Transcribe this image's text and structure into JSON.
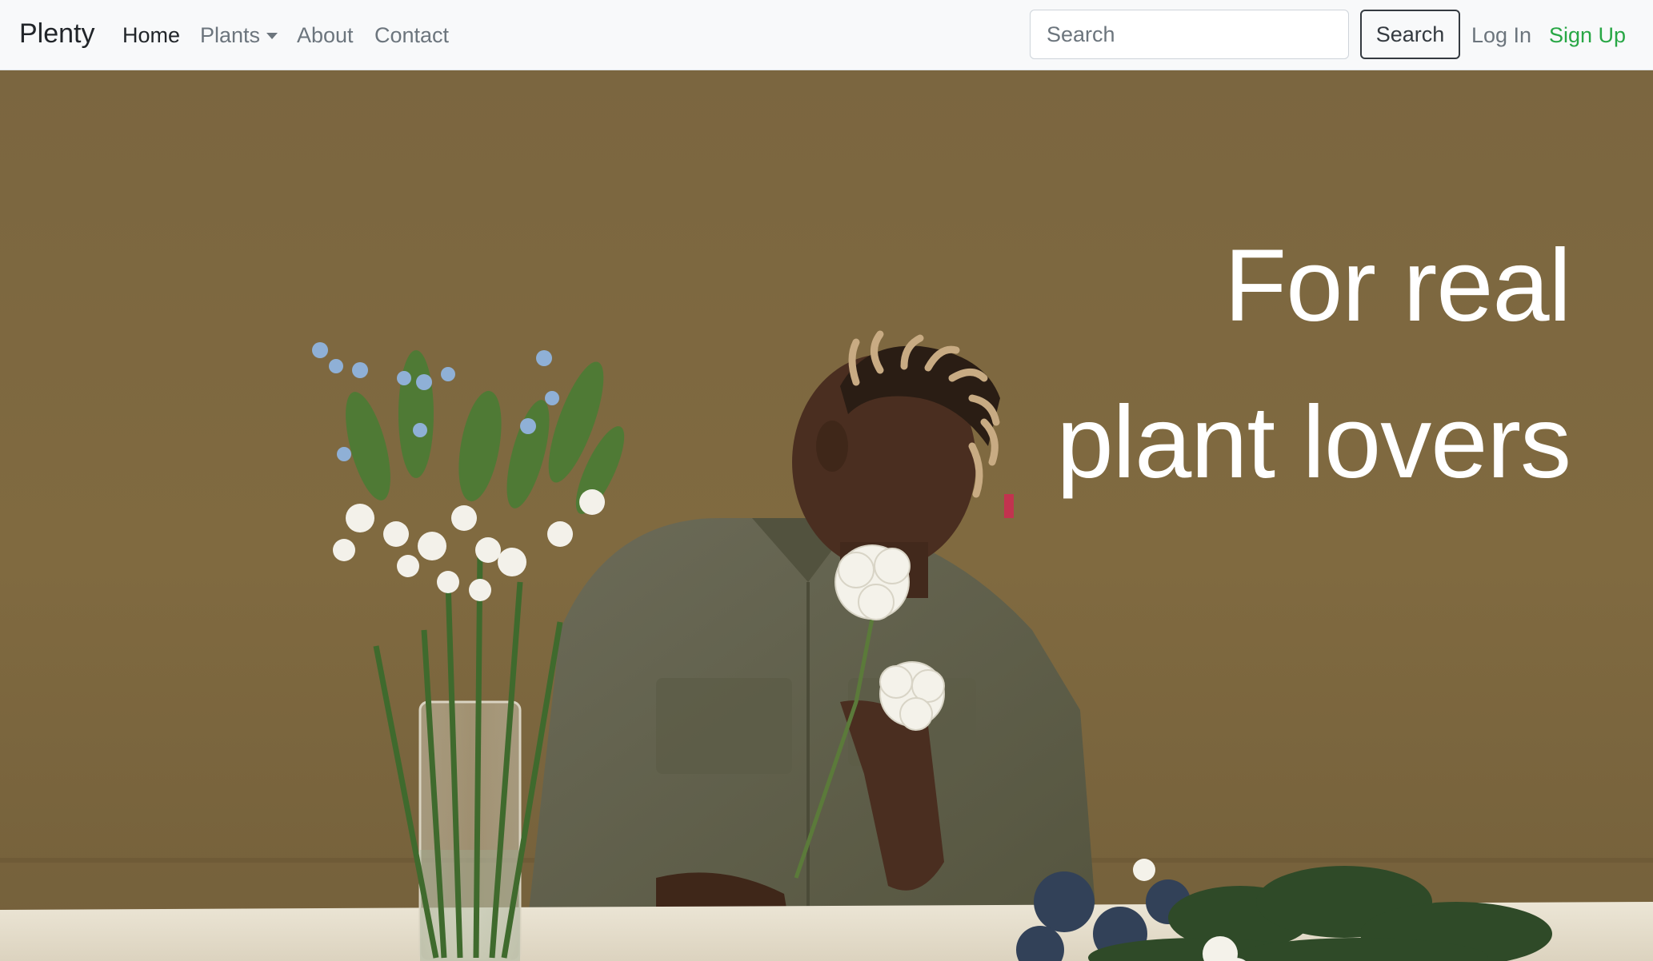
{
  "navbar": {
    "brand": "Plenty",
    "links": {
      "home": "Home",
      "plants": "Plants",
      "about": "About",
      "contact": "Contact"
    },
    "search": {
      "placeholder": "Search",
      "button_label": "Search"
    },
    "login": "Log In",
    "signup": "Sign Up"
  },
  "hero": {
    "headline_line1": "For real",
    "headline_line2": "plant lovers",
    "image_description_icon": "hero-photo"
  },
  "colors": {
    "navbar_bg": "#f8f9fa",
    "link_muted": "#6c757d",
    "link_active": "#212529",
    "signup_green": "#28a745",
    "hero_backdrop": "#7f683e",
    "headline": "#ffffff"
  }
}
